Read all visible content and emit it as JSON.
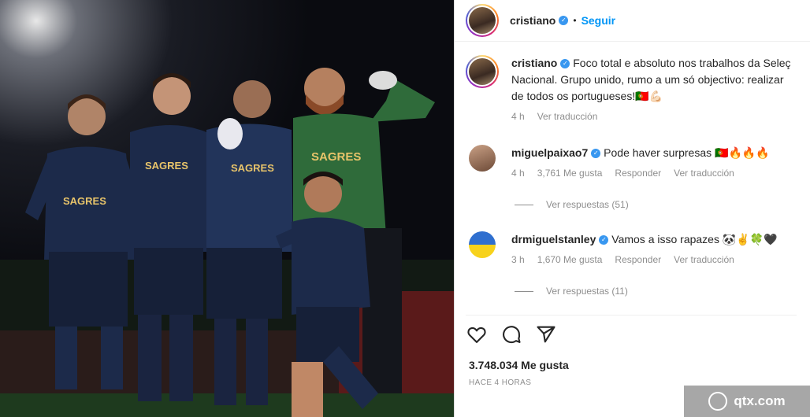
{
  "header": {
    "username": "cristiano",
    "follow_label": "Seguir",
    "separator": "•"
  },
  "caption": {
    "username": "cristiano",
    "text_line1": "Foco total e absoluto nos trabalhos da Seleç",
    "text_line2": "Nacional. Grupo unido, rumo a um só objectivo: realizar",
    "text_line3": "de todos os portugueses!🇵🇹💪🏻",
    "time": "4 h",
    "translate_label": "Ver traducción"
  },
  "comments": [
    {
      "username": "miguelpaixao7",
      "text": "Pode haver surpresas 🇵🇹🔥🔥🔥",
      "time": "4 h",
      "likes": "3,761 Me gusta",
      "reply_label": "Responder",
      "translate_label": "Ver traducción",
      "view_replies": "Ver respuestas (51)"
    },
    {
      "username": "drmiguelstanley",
      "text": "Vamos a isso rapazes 🐼✌️🍀🖤",
      "time": "3 h",
      "likes": "1,670 Me gusta",
      "reply_label": "Responder",
      "translate_label": "Ver traducción",
      "view_replies": "Ver respuestas (11)"
    }
  ],
  "likes_count": "3.748.034 Me gusta",
  "posted_ago": "HACE 4 HORAS",
  "watermark": "qtx.com",
  "photo": {
    "sponsor_text": "SAGRES",
    "icons": [
      "heart-icon",
      "comment-icon",
      "share-icon"
    ]
  },
  "colors": {
    "accent": "#0095f6",
    "verified": "#3897f0",
    "kit_navy": "#1c2a4a",
    "keeper_green": "#2f6b3a"
  }
}
